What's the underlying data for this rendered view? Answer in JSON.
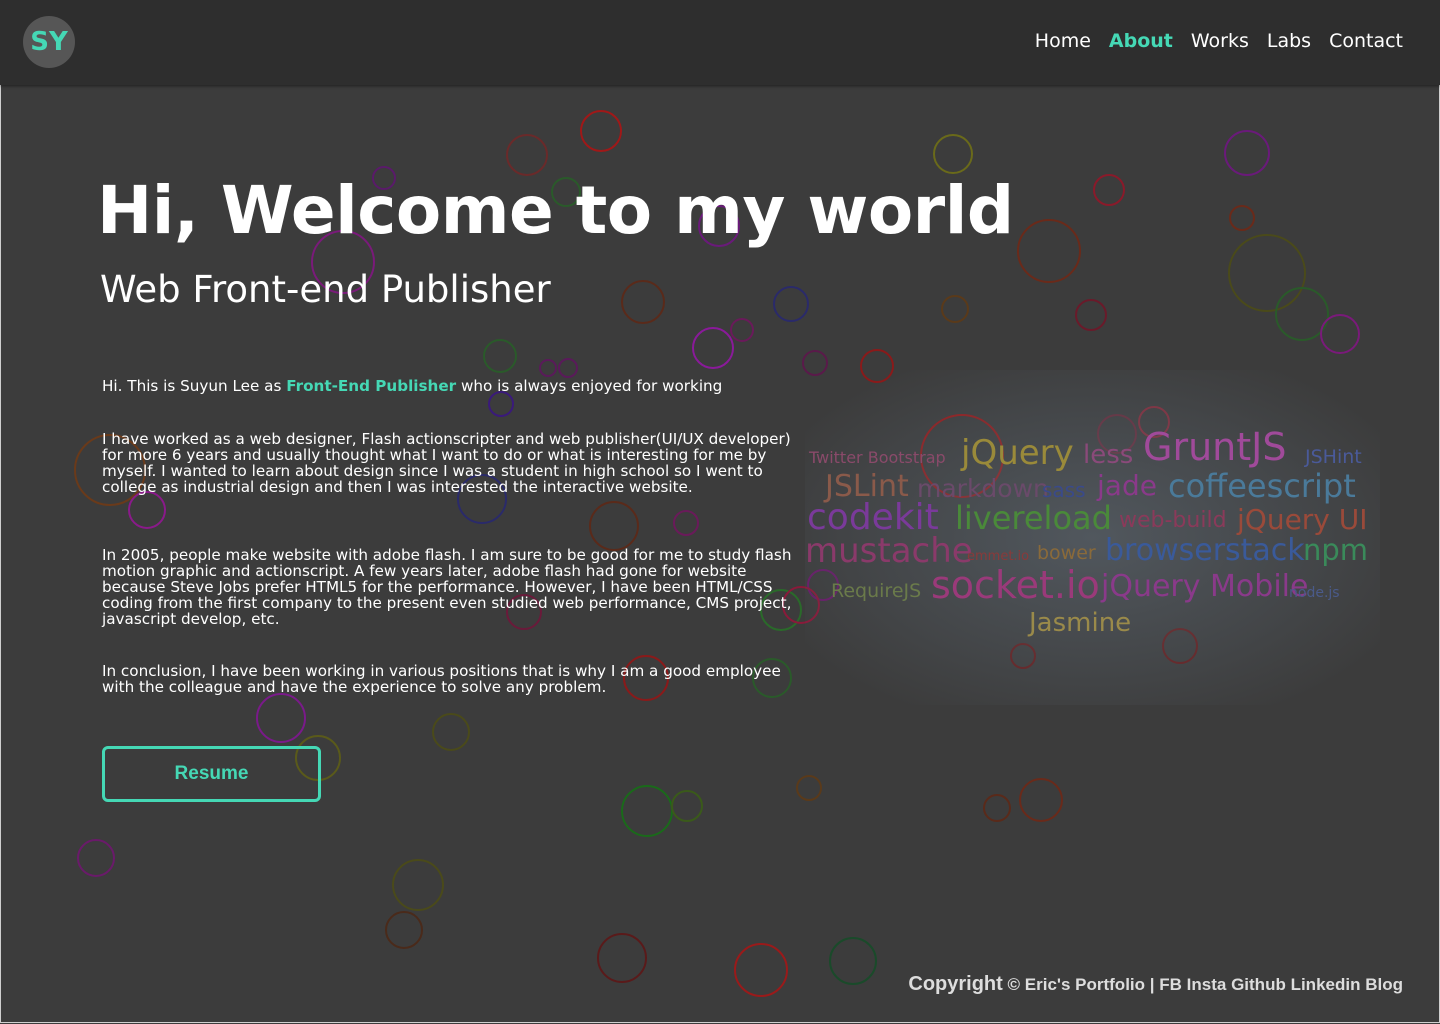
{
  "header": {
    "logo_text": "SY",
    "nav": [
      {
        "label": "Home",
        "active": false
      },
      {
        "label": "About",
        "active": true
      },
      {
        "label": "Works",
        "active": false
      },
      {
        "label": "Labs",
        "active": false
      },
      {
        "label": "Contact",
        "active": false
      }
    ]
  },
  "hero": {
    "title": "Hi, Welcome to my world",
    "subtitle": "Web Front-end Publisher"
  },
  "about": {
    "p1_before": "Hi. This is Suyun Lee as ",
    "p1_highlight": "Front-End Publisher",
    "p1_after": " who is always enjoyed for working",
    "p2": "I have worked as a web designer, Flash actionscripter and web publisher(UI/UX developer) for more 6 years and usually thought what I want to do or what is interesting for me by myself. I wanted to learn about design since I was a student in high school so I went to college as industrial design and then I was interested the interactive website.",
    "p3": "In 2005, people make website with adobe flash. I am sure to be good for me to study flash motion graphic and actionscript. A few years later, adobe flash had gone for website because Steve Jobs prefer HTML5 for the performance. However, I have been HTML/CSS coding from the first company to the present even studied web performance, CMS project, javascript develop, etc.",
    "p4": "In conclusion, I have been working in various positions that is why I am a good employee with the colleague and have the experience to solve any problem.",
    "resume_label": "Resume"
  },
  "skills_cloud": [
    {
      "word": "Twitter Bootstrap",
      "color": "#8a4a6a"
    },
    {
      "word": "jQuery",
      "color": "#9a8a3a"
    },
    {
      "word": "less",
      "color": "#8a4a7a"
    },
    {
      "word": "GruntJS",
      "color": "#a04a9a"
    },
    {
      "word": "JSHint",
      "color": "#4a5a9a"
    },
    {
      "word": "JSLint",
      "color": "#8a5a4a"
    },
    {
      "word": "markdown",
      "color": "#6a4a6a"
    },
    {
      "word": "sass",
      "color": "#3a4a8a"
    },
    {
      "word": "jade",
      "color": "#8a3a8a"
    },
    {
      "word": "coffeescript",
      "color": "#4a7a9a"
    },
    {
      "word": "codekit",
      "color": "#7a3a9a"
    },
    {
      "word": "livereload",
      "color": "#4a8a3a"
    },
    {
      "word": "web-build",
      "color": "#8a3a5a"
    },
    {
      "word": "jQuery UI",
      "color": "#9a4a3a"
    },
    {
      "word": "mustache",
      "color": "#8a3a6a"
    },
    {
      "word": "emmet.io",
      "color": "#8a3a3a"
    },
    {
      "word": "bower",
      "color": "#8a6a3a"
    },
    {
      "word": "browserstack",
      "color": "#3a5a9a"
    },
    {
      "word": "npm",
      "color": "#3a8a5a"
    },
    {
      "word": "RequireJS",
      "color": "#6a7a4a"
    },
    {
      "word": "socket.io",
      "color": "#9a3a7a"
    },
    {
      "word": "jQuery Mobile",
      "color": "#8a3a8a"
    },
    {
      "word": "node.js",
      "color": "#4a5a8a"
    },
    {
      "word": "Jasmine",
      "color": "#9a8a4a"
    }
  ],
  "footer": {
    "copyright_label": "Copyright",
    "copyright_rest": "© Eric's Portfolio |",
    "links": [
      "FB",
      "Insta",
      "Github",
      "Linkedin",
      "Blog"
    ]
  },
  "colors": {
    "accent": "#45d8b5",
    "background": "#3c3c3c",
    "header": "#2e2e2e"
  }
}
